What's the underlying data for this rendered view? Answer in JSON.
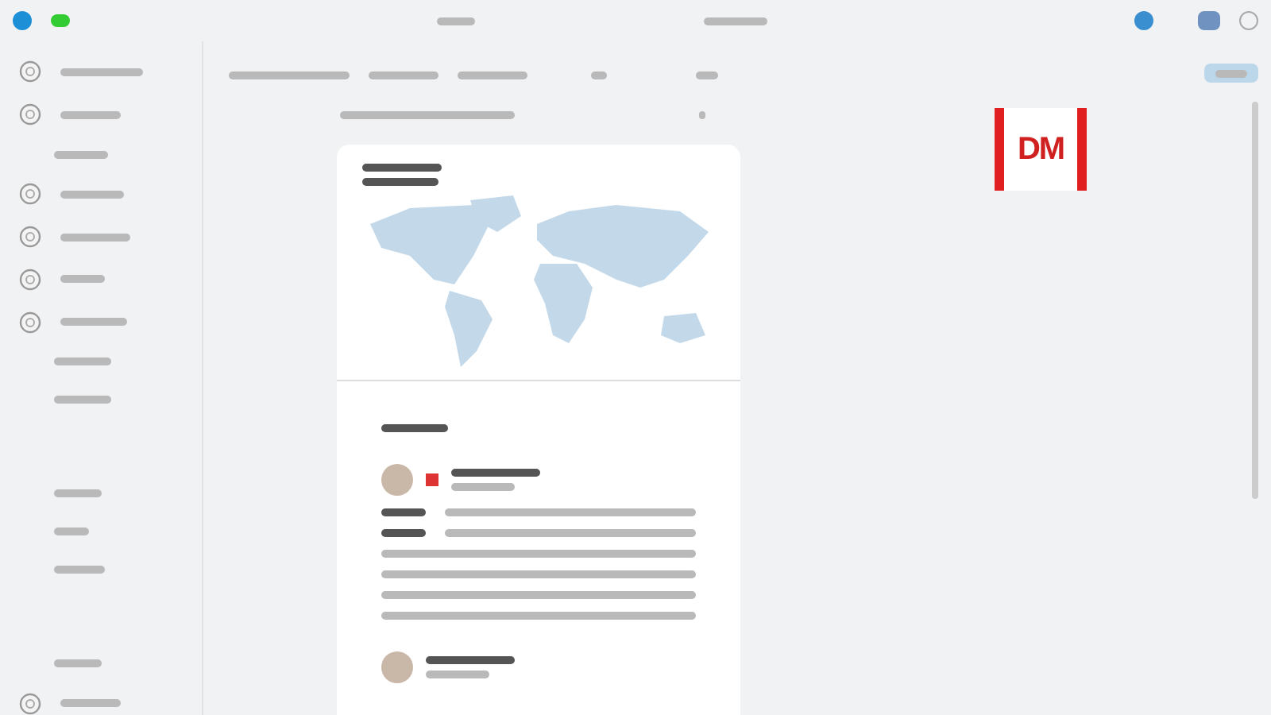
{
  "sidebar": {
    "items": [
      {
        "kind": "icon"
      },
      {
        "kind": "icon"
      },
      {
        "kind": "plain"
      },
      {
        "kind": "icon"
      },
      {
        "kind": "icon"
      },
      {
        "kind": "icon"
      },
      {
        "kind": "icon"
      },
      {
        "kind": "plain"
      },
      {
        "kind": "plain"
      },
      {
        "kind": "gap"
      },
      {
        "kind": "plain"
      },
      {
        "kind": "plain"
      },
      {
        "kind": "plain"
      },
      {
        "kind": "gap"
      },
      {
        "kind": "plain"
      },
      {
        "kind": "icon"
      }
    ]
  },
  "logo": {
    "text": "DM"
  },
  "feed": {
    "posts": [
      {
        "kind": "full"
      },
      {
        "kind": "collapsed"
      }
    ]
  }
}
